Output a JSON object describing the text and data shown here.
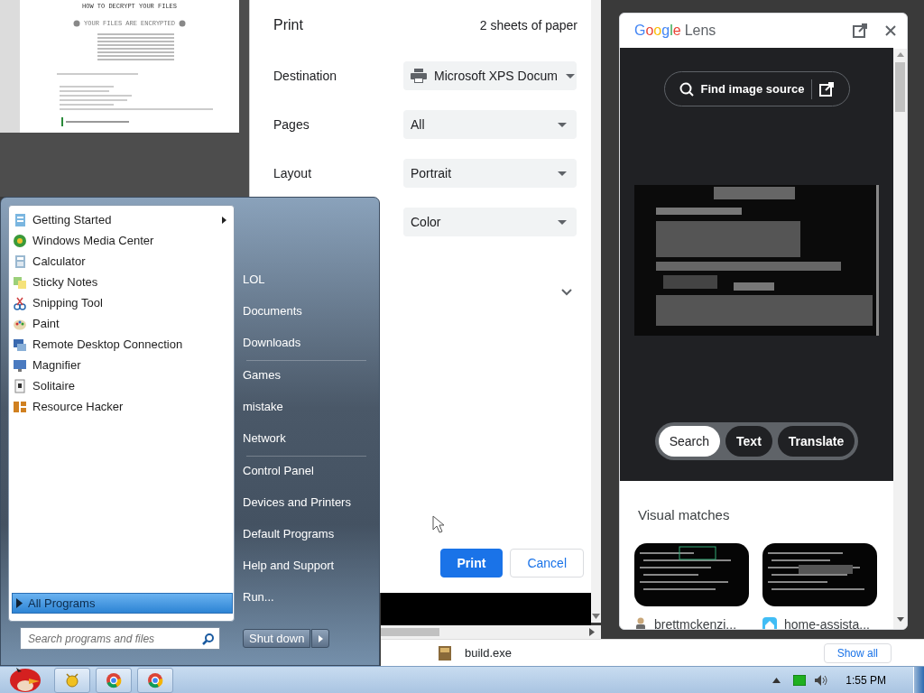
{
  "print_preview": {
    "header_center": "HOW TO DECRYPT YOUR FILES",
    "title": "YOUR FILES ARE ENCRYPTED"
  },
  "print_dialog": {
    "title": "Print",
    "sheets": "2 sheets of paper",
    "settings": [
      {
        "kind": "printer",
        "label": "Destination",
        "value": "Microsoft XPS Docum"
      },
      {
        "kind": "plain",
        "label": "Pages",
        "value": "All"
      },
      {
        "kind": "plain",
        "label": "Layout",
        "value": "Portrait"
      },
      {
        "kind": "plain",
        "value": "Color"
      }
    ],
    "more_settings": {
      "expanded": false
    },
    "buttons": [
      {
        "kind": "primary",
        "label": "Print"
      },
      {
        "kind": "secondary",
        "label": "Cancel"
      }
    ]
  },
  "lens": {
    "brand": "Google",
    "app": "Lens",
    "find_source": "Find image source",
    "chips": [
      {
        "label": "Search",
        "selected": true
      },
      {
        "label": "Text",
        "selected": false
      },
      {
        "label": "Translate",
        "selected": false
      }
    ],
    "visual_matches_title": "Visual matches",
    "matches": [
      {
        "source": "brettmckenzi..."
      },
      {
        "source": "home-assista..."
      }
    ]
  },
  "downloads": {
    "file": "build.exe",
    "show_all": "Show all"
  },
  "start_menu": {
    "programs": [
      {
        "label": "Getting Started",
        "submenu": true
      },
      {
        "label": "Windows Media Center",
        "submenu": false
      },
      {
        "label": "Calculator",
        "submenu": false
      },
      {
        "label": "Sticky Notes",
        "submenu": false
      },
      {
        "label": "Snipping Tool",
        "submenu": false
      },
      {
        "label": "Paint",
        "submenu": false
      },
      {
        "label": "Remote Desktop Connection",
        "submenu": false
      },
      {
        "label": "Magnifier",
        "submenu": false
      },
      {
        "label": "Solitaire",
        "submenu": false
      },
      {
        "label": "Resource Hacker",
        "submenu": false
      }
    ],
    "all_programs": "All Programs",
    "search": {
      "placeholder": "Search programs and files"
    },
    "place_groups": [
      [
        "LOL",
        "Documents",
        "Downloads"
      ],
      [
        "Games",
        "mistake",
        "Network"
      ],
      [
        "Control Panel",
        "Devices and Printers",
        "Default Programs",
        "Help and Support",
        "Run..."
      ]
    ],
    "shutdown": "Shut down"
  },
  "taskbar": {
    "clock": "1:55 PM"
  }
}
